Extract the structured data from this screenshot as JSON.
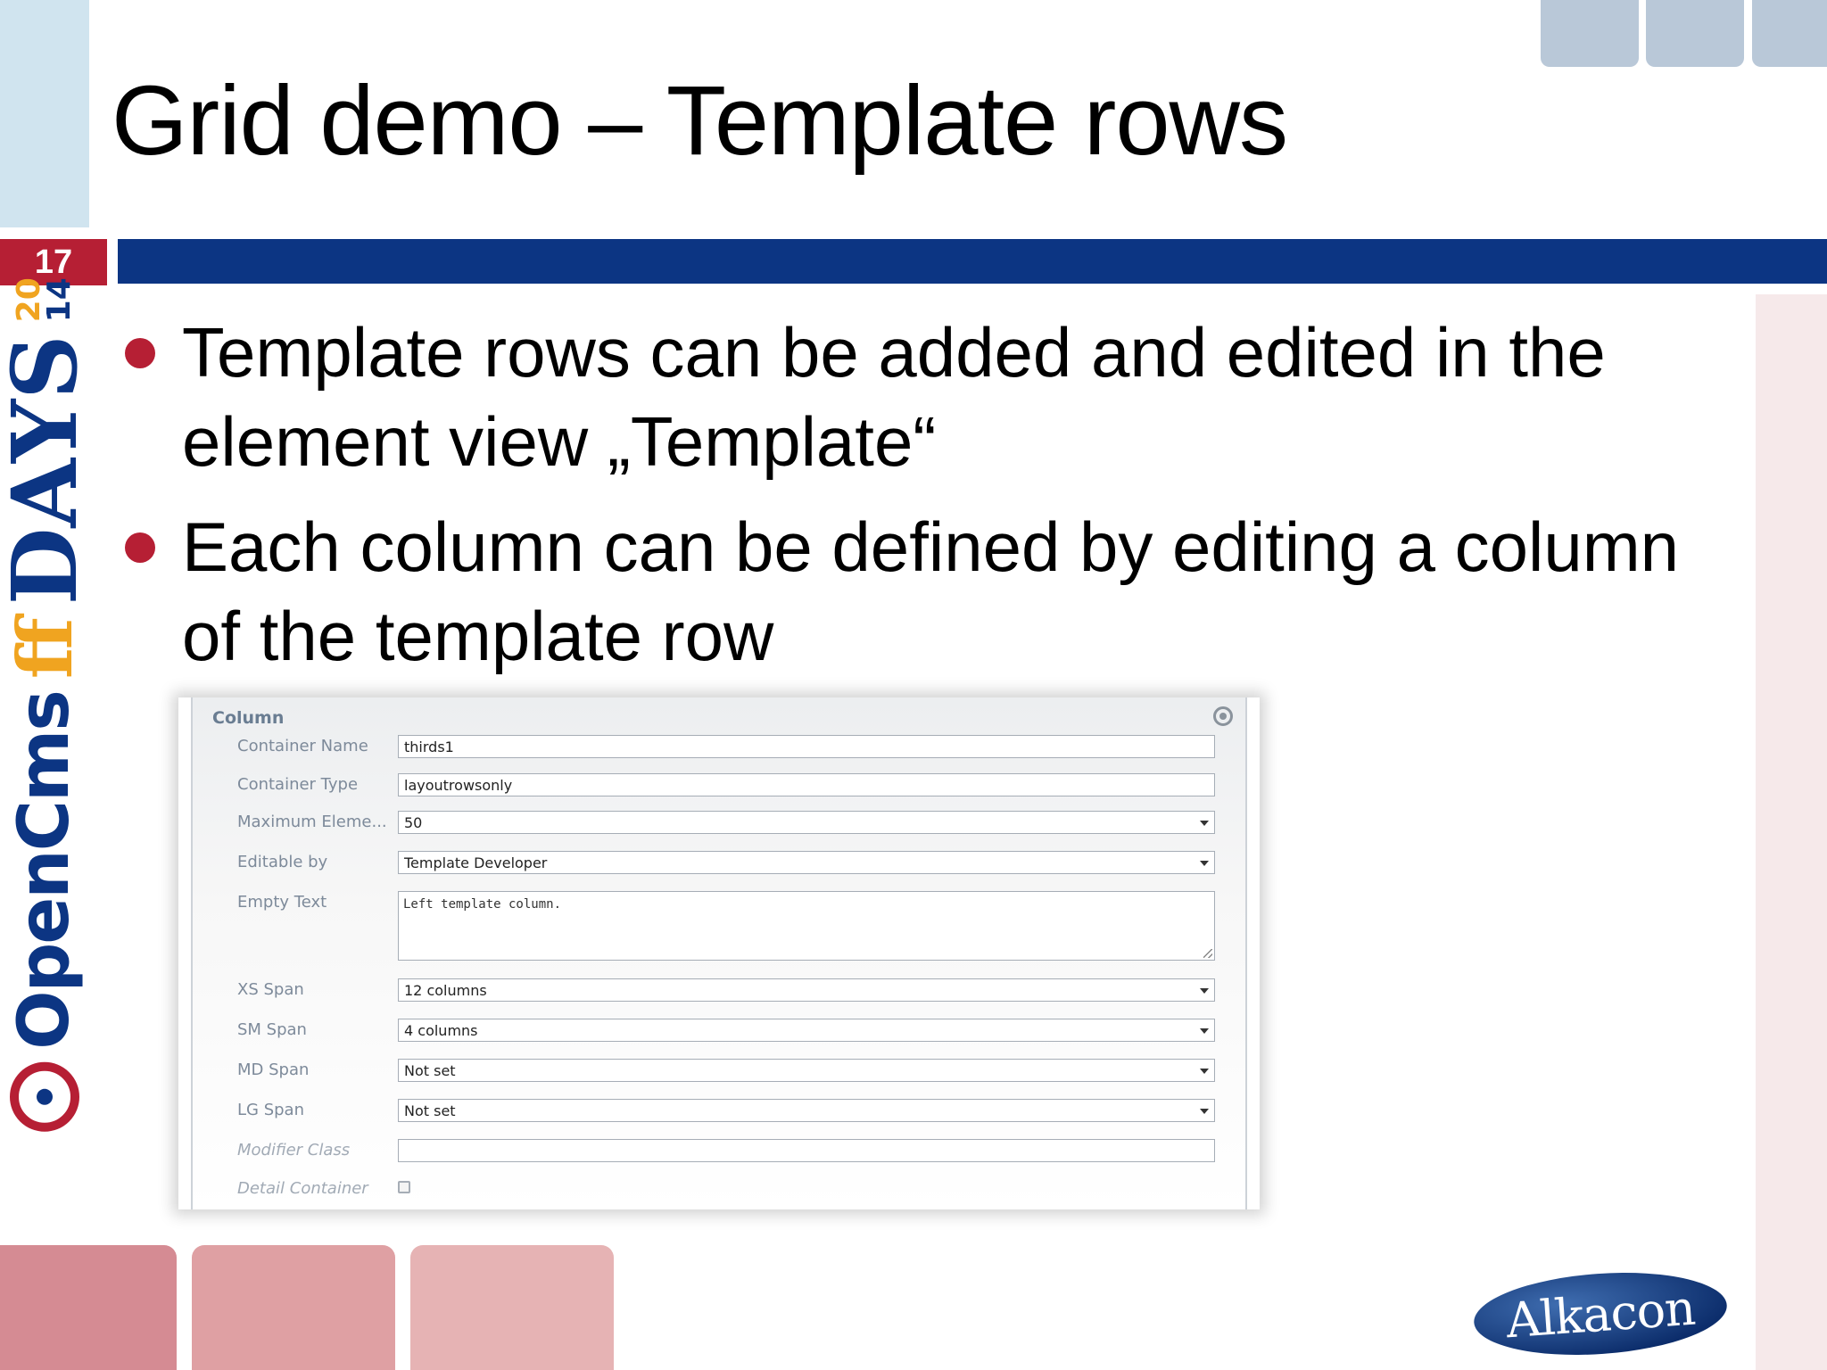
{
  "slide": {
    "number": "17",
    "title": "Grid demo – Template rows",
    "colors": {
      "accent_red": "#b61f34",
      "navy": "#0c3583",
      "flame_orange": "#f0a420"
    }
  },
  "logo": {
    "prefix": "OpenCms",
    "days": "DAYS",
    "year_top": "20",
    "year_bottom": "14"
  },
  "bullets": [
    {
      "text": "Template rows can be added and edited in the element view „Template“"
    },
    {
      "text": "Each column can be defined by editing a column of the template row"
    }
  ],
  "panel": {
    "header": "Column",
    "fields": [
      {
        "label": "Container Name",
        "value": "thirds1",
        "type": "text"
      },
      {
        "label": "Container Type",
        "value": "layoutrowsonly",
        "type": "text"
      },
      {
        "label": "Maximum Eleme...",
        "value": "50",
        "type": "select"
      },
      {
        "label": "Editable by",
        "value": "Template Developer",
        "type": "select"
      },
      {
        "label": "Empty Text",
        "value": "Left template column.",
        "type": "textarea"
      },
      {
        "label": "XS Span",
        "value": "12 columns",
        "type": "select"
      },
      {
        "label": "SM Span",
        "value": "4 columns",
        "type": "select"
      },
      {
        "label": "MD Span",
        "value": "Not set",
        "type": "select"
      },
      {
        "label": "LG Span",
        "value": "Not set",
        "type": "select"
      },
      {
        "label": "Modifier Class",
        "value": "",
        "type": "text"
      },
      {
        "label": "Detail Container",
        "value": "",
        "type": "checkbox"
      }
    ]
  },
  "brand": {
    "name": "Alkacon"
  }
}
